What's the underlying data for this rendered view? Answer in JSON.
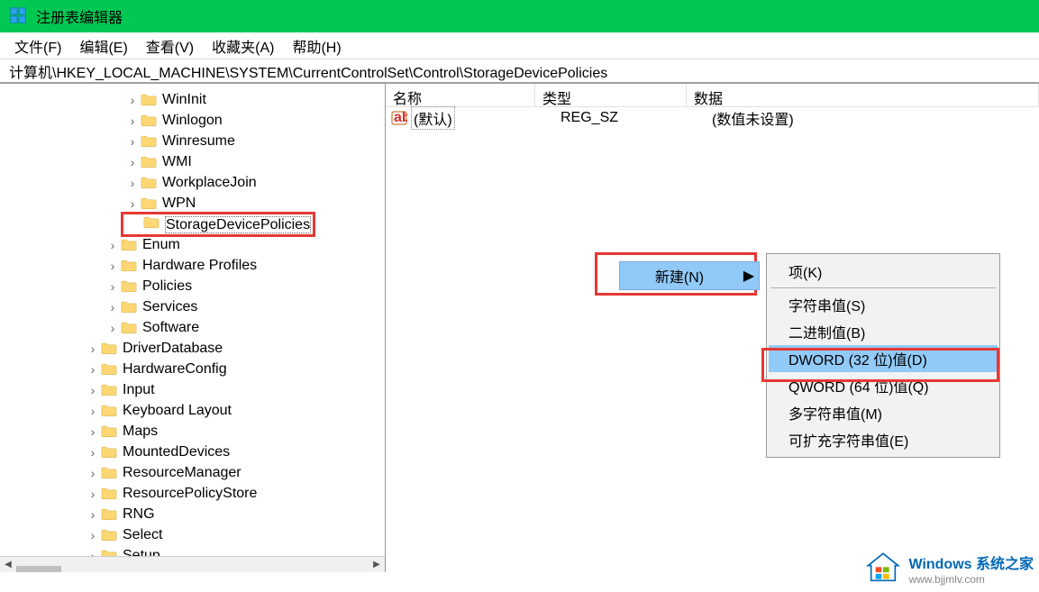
{
  "window": {
    "title": "注册表编辑器"
  },
  "menu": {
    "items": [
      "文件(F)",
      "编辑(E)",
      "查看(V)",
      "收藏夹(A)",
      "帮助(H)"
    ]
  },
  "address": "计算机\\HKEY_LOCAL_MACHINE\\SYSTEM\\CurrentControlSet\\Control\\StorageDevicePolicies",
  "tree": {
    "items": [
      {
        "indent": 140,
        "expander": "closed",
        "label": "WinInit"
      },
      {
        "indent": 140,
        "expander": "closed",
        "label": "Winlogon"
      },
      {
        "indent": 140,
        "expander": "closed",
        "label": "Winresume"
      },
      {
        "indent": 140,
        "expander": "closed",
        "label": "WMI"
      },
      {
        "indent": 140,
        "expander": "closed",
        "label": "WorkplaceJoin"
      },
      {
        "indent": 140,
        "expander": "closed",
        "label": "WPN"
      },
      {
        "indent": 140,
        "expander": "none",
        "label": "StorageDevicePolicies",
        "selected": true,
        "redbox": true
      },
      {
        "indent": 118,
        "expander": "closed",
        "label": "Enum"
      },
      {
        "indent": 118,
        "expander": "closed",
        "label": "Hardware Profiles"
      },
      {
        "indent": 118,
        "expander": "closed",
        "label": "Policies"
      },
      {
        "indent": 118,
        "expander": "closed",
        "label": "Services"
      },
      {
        "indent": 118,
        "expander": "closed",
        "label": "Software"
      },
      {
        "indent": 96,
        "expander": "closed",
        "label": "DriverDatabase"
      },
      {
        "indent": 96,
        "expander": "closed",
        "label": "HardwareConfig"
      },
      {
        "indent": 96,
        "expander": "closed",
        "label": "Input"
      },
      {
        "indent": 96,
        "expander": "closed",
        "label": "Keyboard Layout"
      },
      {
        "indent": 96,
        "expander": "closed",
        "label": "Maps"
      },
      {
        "indent": 96,
        "expander": "closed",
        "label": "MountedDevices"
      },
      {
        "indent": 96,
        "expander": "closed",
        "label": "ResourceManager"
      },
      {
        "indent": 96,
        "expander": "closed",
        "label": "ResourcePolicyStore"
      },
      {
        "indent": 96,
        "expander": "closed",
        "label": "RNG"
      },
      {
        "indent": 96,
        "expander": "closed",
        "label": "Select"
      },
      {
        "indent": 96,
        "expander": "closed",
        "label": "Setup"
      }
    ]
  },
  "list": {
    "columns": {
      "name": "名称",
      "type": "类型",
      "data": "数据"
    },
    "rows": [
      {
        "name": "(默认)",
        "type": "REG_SZ",
        "data": "(数值未设置)"
      }
    ]
  },
  "context_new": {
    "label": "新建(N)"
  },
  "context_menu": {
    "items": [
      {
        "label": "项(K)"
      },
      {
        "sep": true
      },
      {
        "label": "字符串值(S)"
      },
      {
        "label": "二进制值(B)"
      },
      {
        "label": "DWORD (32 位)值(D)",
        "highlight": true,
        "redbox": true
      },
      {
        "label": "QWORD (64 位)值(Q)"
      },
      {
        "label": "多字符串值(M)"
      },
      {
        "label": "可扩充字符串值(E)"
      }
    ]
  },
  "watermark": {
    "line1": "Windows 系统之家",
    "line2": "www.bjjmlv.com"
  }
}
